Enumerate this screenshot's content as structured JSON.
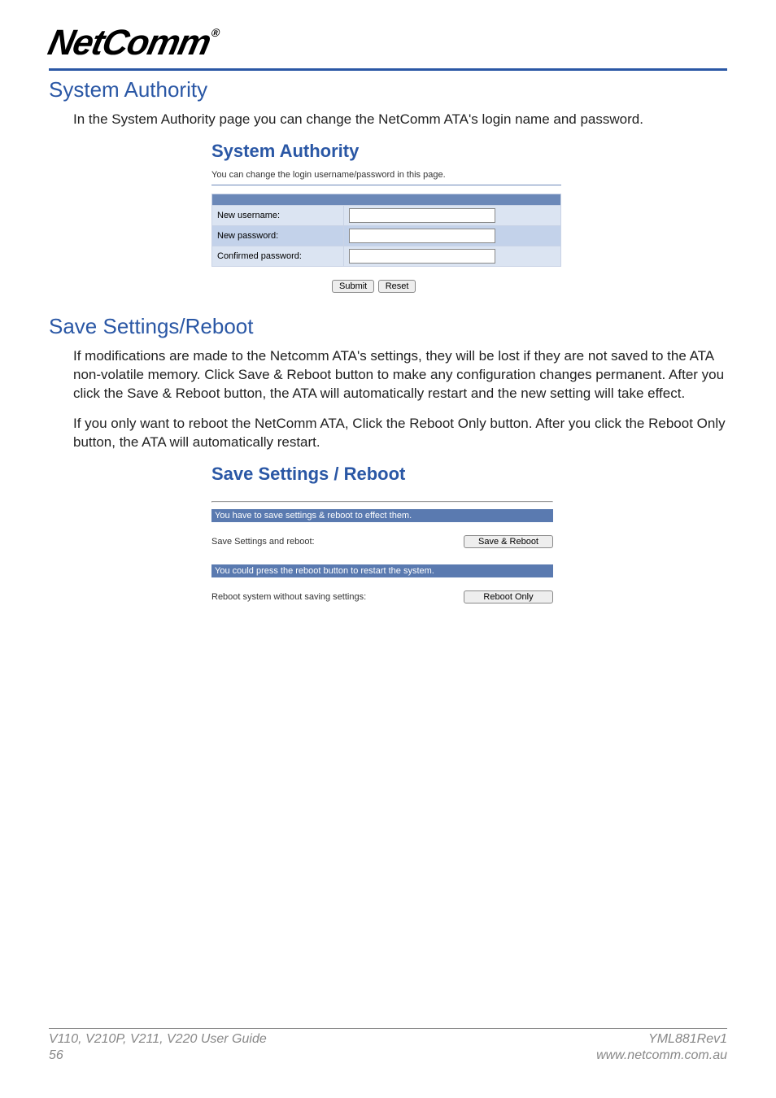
{
  "brand": {
    "name": "NetComm",
    "reg": "®"
  },
  "section1": {
    "title": "System Authority",
    "intro": "In the System Authority page you can change the NetComm ATA's login name and password.",
    "embed": {
      "heading": "System Authority",
      "subtext": "You can change the login username/password in this page.",
      "rows": {
        "new_username": "New username:",
        "new_password": "New password:",
        "confirmed_password": "Confirmed password:"
      },
      "buttons": {
        "submit": "Submit",
        "reset": "Reset"
      }
    }
  },
  "section2": {
    "title": "Save Settings/Reboot",
    "p1": "If modifications are made to the Netcomm ATA's settings, they will be lost if they are not saved to the ATA non-volatile memory. Click Save & Reboot button to make any configuration changes permanent. After you click the Save & Reboot button, the ATA will automatically restart and the new setting will take effect.",
    "p2": "If you only want to reboot the NetComm ATA, Click the Reboot Only button. After you click the Reboot Only button, the ATA will automatically restart.",
    "embed": {
      "heading": "Save Settings / Reboot",
      "banner1": "You have to save settings & reboot to effect them.",
      "row1_label": "Save Settings and reboot:",
      "row1_button": "Save & Reboot",
      "banner2": "You could press the reboot button to restart the system.",
      "row2_label": "Reboot system without saving settings:",
      "row2_button": "Reboot Only"
    }
  },
  "footer": {
    "guide": "V110, V210P, V211, V220 User Guide",
    "page": "56",
    "doc": "YML881Rev1",
    "url": "www.netcomm.com.au"
  }
}
